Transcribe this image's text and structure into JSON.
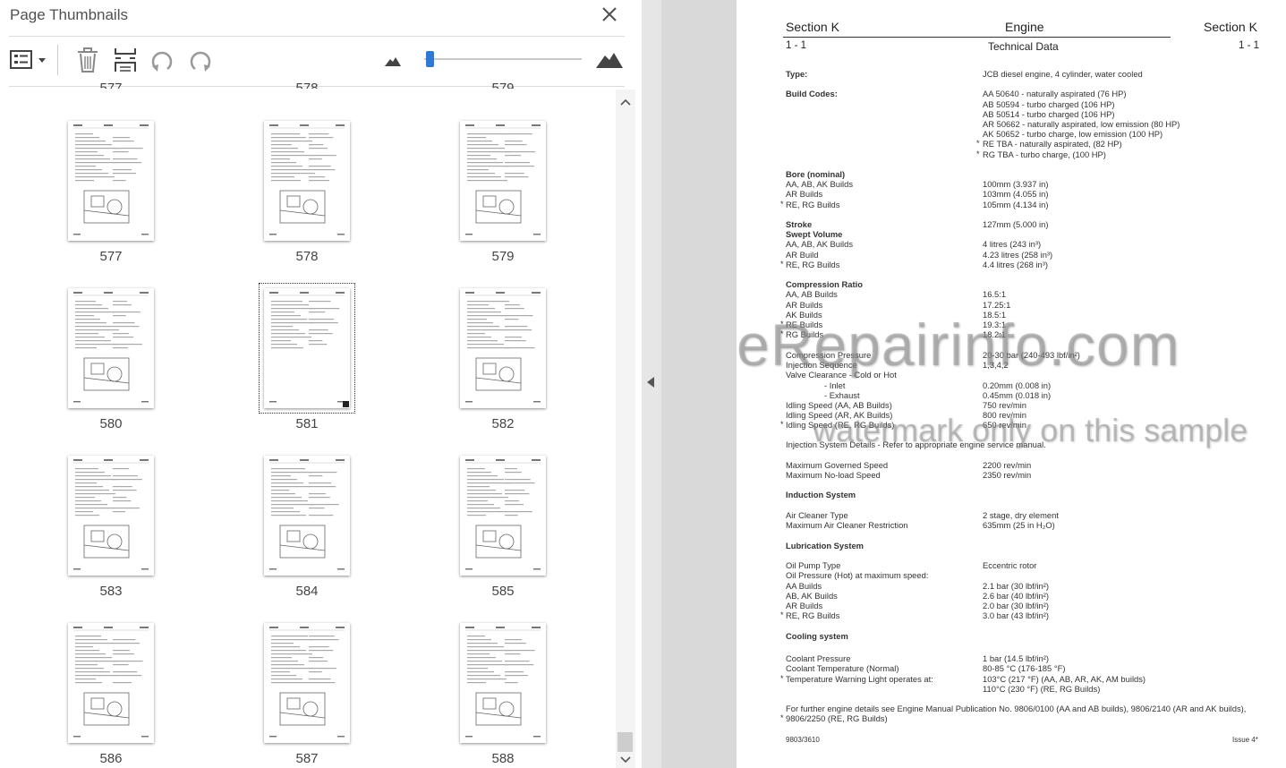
{
  "panel": {
    "title": "Page Thumbnails",
    "partial_labels": [
      "577",
      "578",
      "579"
    ],
    "thumbnails": [
      {
        "label": "577"
      },
      {
        "label": "578"
      },
      {
        "label": "579"
      },
      {
        "label": "580"
      },
      {
        "label": "581",
        "selected": true
      },
      {
        "label": "582"
      },
      {
        "label": "583"
      },
      {
        "label": "584"
      },
      {
        "label": "585"
      },
      {
        "label": "586"
      },
      {
        "label": "587"
      },
      {
        "label": "588"
      }
    ],
    "zoom_level": 0.05
  },
  "toolbar_icons": [
    "page-options-icon",
    "trash-icon",
    "insert-page-icon",
    "rotate-ccw-icon",
    "rotate-cw-icon",
    "zoom-out-icon",
    "zoom-in-icon"
  ],
  "doc": {
    "header": {
      "section_left": "Section K",
      "title": "Engine",
      "section_right": "Section K",
      "page_left": "1 - 1",
      "subtitle": "Technical Data",
      "page_right": "1 - 1"
    },
    "rows": [
      {
        "label": "Type:",
        "value": "JCB diesel engine, 4 cylinder, water cooled",
        "bold": true
      },
      {
        "label": "Build Codes:",
        "value": "AA 50640 - naturally aspirated (76 HP)",
        "bold": true
      },
      {
        "label": "",
        "value": "AB 50594 - turbo charged (106 HP)"
      },
      {
        "label": "",
        "value": "AB 50514 - turbo charged (106 HP)"
      },
      {
        "label": "",
        "value": "AR 50662 - naturally aspirated, low emission (80 HP)"
      },
      {
        "label": "",
        "value": "AK 50652 - turbo charge, low emission (100 HP)"
      },
      {
        "label": "",
        "value": "RE TBA - naturally aspirated, (82 HP)",
        "star": true
      },
      {
        "label": "",
        "value": "RG TBA - turbo charge, (100 HP)",
        "star": true
      },
      {
        "label": "Bore (nominal)",
        "value": "",
        "bold": true
      },
      {
        "label": "AA, AB, AK Builds",
        "value": "100mm (3.937 in)"
      },
      {
        "label": "AR Builds",
        "value": "103mm (4.055 in)"
      },
      {
        "label": "RE, RG Builds",
        "value": "105mm (4.134 in)",
        "star": true
      },
      {
        "label": "Stroke",
        "value": "127mm (5.000 in)",
        "bold": true
      },
      {
        "label": "Swept Volume",
        "value": "",
        "bold": true
      },
      {
        "label": "AA, AB, AK Builds",
        "value": "4 litres (243 in³)"
      },
      {
        "label": "AR Build",
        "value": "4.23 litres (258 in³)"
      },
      {
        "label": "RE, RG Builds",
        "value": "4.4 litres (268 in³)",
        "star": true
      },
      {
        "label": "Compression Ratio",
        "value": "",
        "bold": true
      },
      {
        "label": "AA, AB Builds",
        "value": "16.5:1"
      },
      {
        "label": "AR Builds",
        "value": "17.25:1"
      },
      {
        "label": "AK Builds",
        "value": "18.5:1"
      },
      {
        "label": "RE Builds",
        "value": "19.3:1",
        "star": true
      },
      {
        "label": "RG Builds",
        "value": "18.2:1",
        "star": true
      },
      {
        "label": "Compression Pressure",
        "value": "20-30 bar (240-493 lbf/in²)"
      },
      {
        "label": "Injection Sequence",
        "value": "1,3,4,2"
      },
      {
        "label": "Valve Clearance - Cold or Hot",
        "value": ""
      },
      {
        "label": "- Inlet",
        "value": "0.20mm (0.008 in)",
        "indent": true
      },
      {
        "label": "- Exhaust",
        "value": "0.45mm (0.018 in)",
        "indent": true
      },
      {
        "label": "Idling Speed (AA, AB Builds)",
        "value": "750 rev/min"
      },
      {
        "label": "Idling Speed (AR, AK Builds)",
        "value": "800 rev/min"
      },
      {
        "label": "Idling Speed (RE, RG Builds)",
        "value": "650 rev/min",
        "star": true
      },
      {
        "label": "Injection System Details - Refer to  appropriate engine service manual.",
        "value": ""
      },
      {
        "label": "Maximum Governed Speed",
        "value": "2200 rev/min"
      },
      {
        "label": "Maximum No-load Speed",
        "value": "2350 rev/min"
      },
      {
        "label": "Induction System",
        "value": "",
        "bold": true
      },
      {
        "label": "Air Cleaner Type",
        "value": "2 stage, dry element"
      },
      {
        "label": "Maximum Air Cleaner Restriction",
        "value": "635mm (25 in H₂O)"
      },
      {
        "label": "Lubrication System",
        "value": "",
        "bold": true
      },
      {
        "label": "Oil Pump Type",
        "value": "Eccentric rotor"
      },
      {
        "label": "Oil Pressure (Hot) at maximum speed:",
        "value": ""
      },
      {
        "label": "AA Builds",
        "value": "2.1 bar (30 lbf/in²)"
      },
      {
        "label": "AB, AK Builds",
        "value": "2.6 bar (40 lbf/in²)"
      },
      {
        "label": "AR Builds",
        "value": "2.0 bar (30 lbf/in²)"
      },
      {
        "label": "RE, RG Builds",
        "value": "3.0 bar (43 lbf/in²)",
        "star": true
      },
      {
        "label": "Cooling system",
        "value": "",
        "bold": true
      },
      {
        "label": "Coolant Pressure",
        "value": "1 bar (14.5 lbf/in²)"
      },
      {
        "label": "Coolant Temperature (Normal)",
        "value": "80-85 °C (176-185 °F)"
      },
      {
        "label": "Temperature Warning Light operates at:",
        "value": "103°C (217 °F) (AA, AB, AR, AK, AM  builds)",
        "star": true
      },
      {
        "label": "",
        "value": "110°C (230 °F) (RE, RG Builds)"
      }
    ],
    "footnote_1": "For further engine details see Engine Manual Publication No. 9806/0100 (AA and AB builds), 9806/2140 (AR and AK builds),",
    "footnote_2": "9806/2250 (RE, RG Builds)",
    "footer_left": "9803/3610",
    "footer_right": "Issue 4*"
  },
  "watermark": {
    "line1": "eRepairinfo.com",
    "line2": "watermark only on this sample"
  }
}
